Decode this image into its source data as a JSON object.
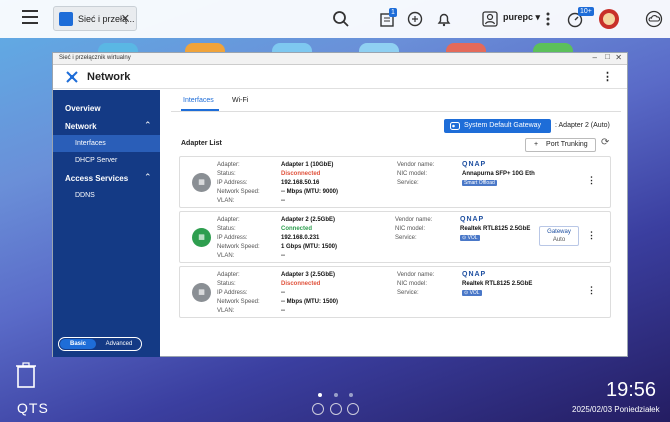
{
  "topbar": {
    "tab_title": "Sieć i przełą...",
    "tab_close": "✕",
    "user": "purepc ▾",
    "badge_tasks": "1",
    "badge_notifications": "10+"
  },
  "window": {
    "title": "Sieć i przełącznik wirtualny",
    "app_name": "Network",
    "more": "⋮"
  },
  "sidebar": {
    "overview": "Overview",
    "network": "Network",
    "interfaces": "Interfaces",
    "dhcp": "DHCP Server",
    "access": "Access Services",
    "ddns": "DDNS",
    "basic": "Basic",
    "advanced": "Advanced"
  },
  "tabs": {
    "interfaces": "Interfaces",
    "wifi": "Wi-Fi"
  },
  "gateway": {
    "button": "System Default Gateway",
    "value": ": Adapter 2 (Auto)"
  },
  "adapter_list": {
    "title": "Adapter List",
    "port_trunking": "Port Trunking"
  },
  "labels": {
    "adapter": "Adapter:",
    "status": "Status:",
    "ip": "IP Address:",
    "speed": "Network Speed:",
    "vlan": "VLAN:",
    "vendor": "Vendor name:",
    "nic": "NIC model:",
    "service": "Service:"
  },
  "adapters": [
    {
      "name": "Adapter 1 (10GbE)",
      "status": "Disconnected",
      "ip": "192.168.50.16",
      "speed": "-- Mbps (MTU: 9000)",
      "vlan": "--",
      "vendor": "QNAP",
      "nic": "Annapurna SFP+ 10G Eth",
      "service": "Smart Offload"
    },
    {
      "name": "Adapter 2 (2.5GbE)",
      "status": "Connected",
      "ip": "192.168.0.231",
      "speed": "1 Gbps (MTU: 1500)",
      "vlan": "--",
      "vendor": "QNAP",
      "nic": "Realtek RTL8125 2.5GbE",
      "service": "⊙ VOL",
      "gateway": "Gateway",
      "gateway_mode": "Auto"
    },
    {
      "name": "Adapter 3 (2.5GbE)",
      "status": "Disconnected",
      "ip": "--",
      "speed": "-- Mbps (MTU: 1500)",
      "vlan": "--",
      "vendor": "QNAP",
      "nic": "Realtek RTL8125 2.5GbE",
      "service": "⊙ VOL"
    }
  ],
  "desktop": {
    "brand": "QTS",
    "time": "19:56",
    "date": "2025/02/03 Poniedziałek"
  },
  "colors": {
    "accent": "#1e6dd8",
    "sidebar": "#143a85",
    "connected": "#2e9e4f",
    "disconnected": "#e0533d"
  }
}
